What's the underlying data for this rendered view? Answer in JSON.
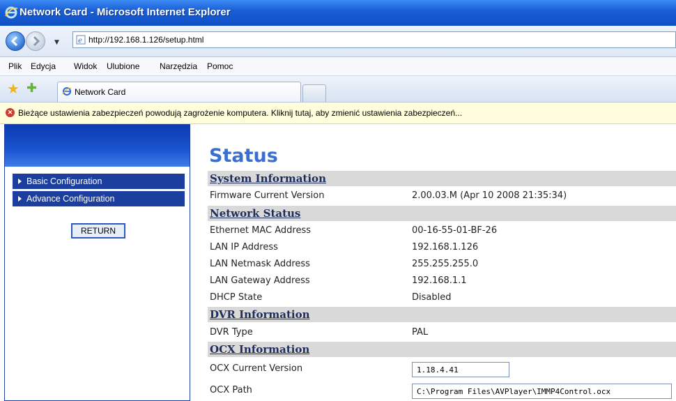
{
  "browser": {
    "window_title": "Network Card - Microsoft Internet Explorer",
    "url": "http://192.168.1.126/setup.html",
    "menu": [
      "Plik",
      "Edycja",
      "Widok",
      "Ulubione",
      "Narzędzia",
      "Pomoc"
    ],
    "tab_title": "Network Card",
    "info_bar": "Bieżące ustawienia zabezpieczeń powodują zagrożenie komputera. Kliknij tutaj, aby zmienić ustawienia zabezpieczeń..."
  },
  "sidebar": {
    "items": [
      {
        "label": "Basic Configuration"
      },
      {
        "label": "Advance Configuration"
      }
    ],
    "return_label": "RETURN"
  },
  "main": {
    "title": "Status",
    "sections": [
      {
        "title": "System Information",
        "rows": [
          {
            "label": "Firmware Current Version",
            "value": "2.00.03.M (Apr 10 2008 21:35:34)"
          }
        ]
      },
      {
        "title": "Network Status",
        "rows": [
          {
            "label": "Ethernet MAC Address",
            "value": "00-16-55-01-BF-26"
          },
          {
            "label": "LAN IP Address",
            "value": "192.168.1.126"
          },
          {
            "label": "LAN Netmask Address",
            "value": "255.255.255.0"
          },
          {
            "label": "LAN Gateway Address",
            "value": "192.168.1.1"
          },
          {
            "label": "DHCP State",
            "value": "Disabled"
          }
        ]
      },
      {
        "title": "DVR Information",
        "rows": [
          {
            "label": "DVR Type",
            "value": "PAL"
          }
        ]
      },
      {
        "title": "OCX Information",
        "rows": [
          {
            "label": "OCX Current Version",
            "value": "1.18.4.41"
          },
          {
            "label": "OCX Path",
            "value": "C:\\Program Files\\AVPlayer\\IMMP4Control.ocx"
          }
        ]
      }
    ]
  }
}
